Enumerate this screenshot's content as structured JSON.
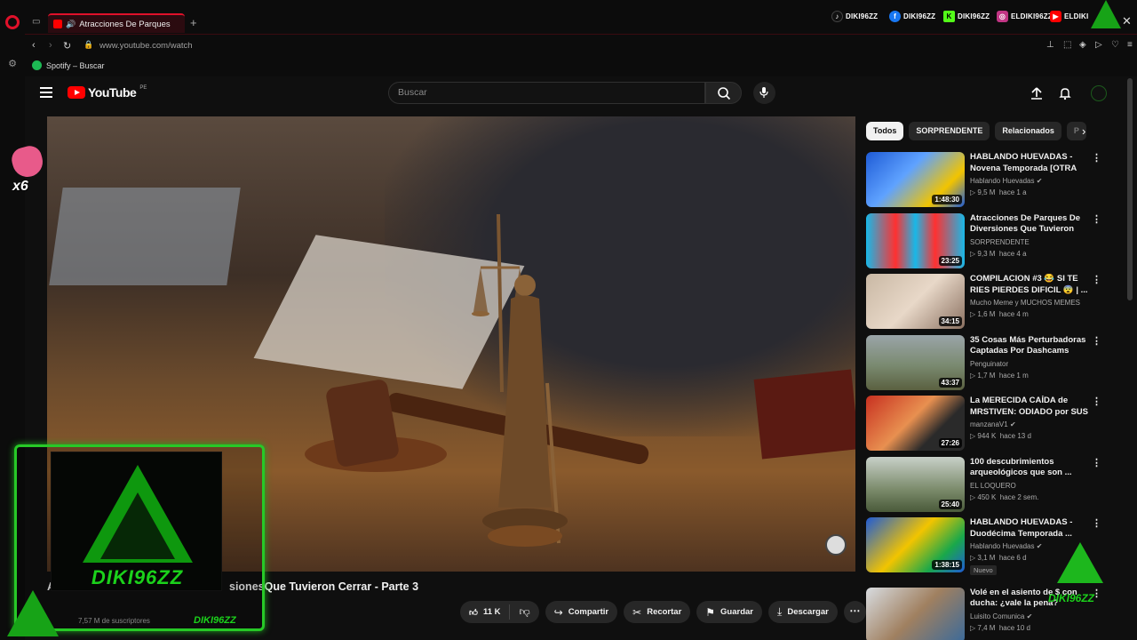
{
  "browser": {
    "tab_title": "Atracciones De Parques",
    "url": "www.youtube.com/watch",
    "bookmark": "Spotify – Buscar",
    "social": [
      {
        "name": "DIKI96ZZ",
        "icon": "tiktok-icon",
        "color": "#111111"
      },
      {
        "name": "DIKI96ZZ",
        "icon": "facebook-icon",
        "color": "#1877f2"
      },
      {
        "name": "DIKI96ZZ",
        "icon": "kick-icon",
        "color": "#53fc18"
      },
      {
        "name": "ELDIKI96ZZ",
        "icon": "instagram-icon",
        "color": "#c13584"
      },
      {
        "name": "ELDIKI",
        "icon": "youtube-icon",
        "color": "#ff0000"
      }
    ]
  },
  "youtube": {
    "logo_text": "YouTube",
    "country": "PE",
    "search_placeholder": "Buscar",
    "video_title": "sionesQue Tuvieron Cerrar - Parte 3",
    "video_title_prefix": "A",
    "subscribers": "7,57 M de suscriptores",
    "likes": "11 K",
    "actions": {
      "share": "Compartir",
      "clip": "Recortar",
      "save": "Guardar",
      "download": "Descargar"
    },
    "chips": [
      "Todos",
      "SORPRENDENTE",
      "Relacionados",
      "P"
    ],
    "recommendations": [
      {
        "title": "HABLANDO HUEVADAS - Novena Temporada [OTRA VE...",
        "channel": "Hablando Huevadas",
        "verified": true,
        "views": "9,5 M",
        "age": "hace 1 a",
        "duration": "1:48:30"
      },
      {
        "title": "Atracciones De Parques De Diversiones Que Tuvieron Cerr...",
        "channel": "SORPRENDENTE",
        "verified": false,
        "views": "9,3 M",
        "age": "hace 4 a",
        "duration": "23:25"
      },
      {
        "title": "COMPILACION #3 😂 SI TE RIES PIERDES DIFICIL 😨 | ...",
        "channel": "Mucho Meme y MUCHOS MEMES",
        "verified": false,
        "views": "1,6 M",
        "age": "hace 4 m",
        "duration": "34:15"
      },
      {
        "title": "35 Cosas Más Perturbadoras Captadas Por Dashcams",
        "channel": "Penguinator",
        "verified": false,
        "views": "1,7 M",
        "age": "hace 1 m",
        "duration": "43:37"
      },
      {
        "title": "La MERECIDA CAÍDA de MRSTIVEN: ODIADO por SUS ...",
        "channel": "manzanaV1",
        "verified": true,
        "views": "944 K",
        "age": "hace 13 d",
        "duration": "27:26"
      },
      {
        "title": "100 descubrimientos arqueológicos que son ...",
        "channel": "EL LOQUERO",
        "verified": false,
        "views": "450 K",
        "age": "hace 2 sem.",
        "duration": "25:40"
      },
      {
        "title": "HABLANDO HUEVADAS - Duodécima Temporada ...",
        "channel": "Hablando Huevadas",
        "verified": true,
        "views": "3,1 M",
        "age": "hace 6 d",
        "duration": "1:38:15",
        "badge": "Nuevo"
      },
      {
        "title": "Volé en el asiento de $ con ducha: ¿vale la pena?",
        "channel": "Luisito Comunica",
        "verified": true,
        "views": "7,4 M",
        "age": "hace 10 d",
        "duration": ""
      }
    ]
  },
  "overlay": {
    "streamer_name": "DIKI96ZZ",
    "multiplier": "x6",
    "brand_color": "#1bd11b"
  },
  "colors": {
    "accent_red": "#e0112a",
    "yt_red": "#ff0000",
    "bg": "#0f0f0f"
  }
}
